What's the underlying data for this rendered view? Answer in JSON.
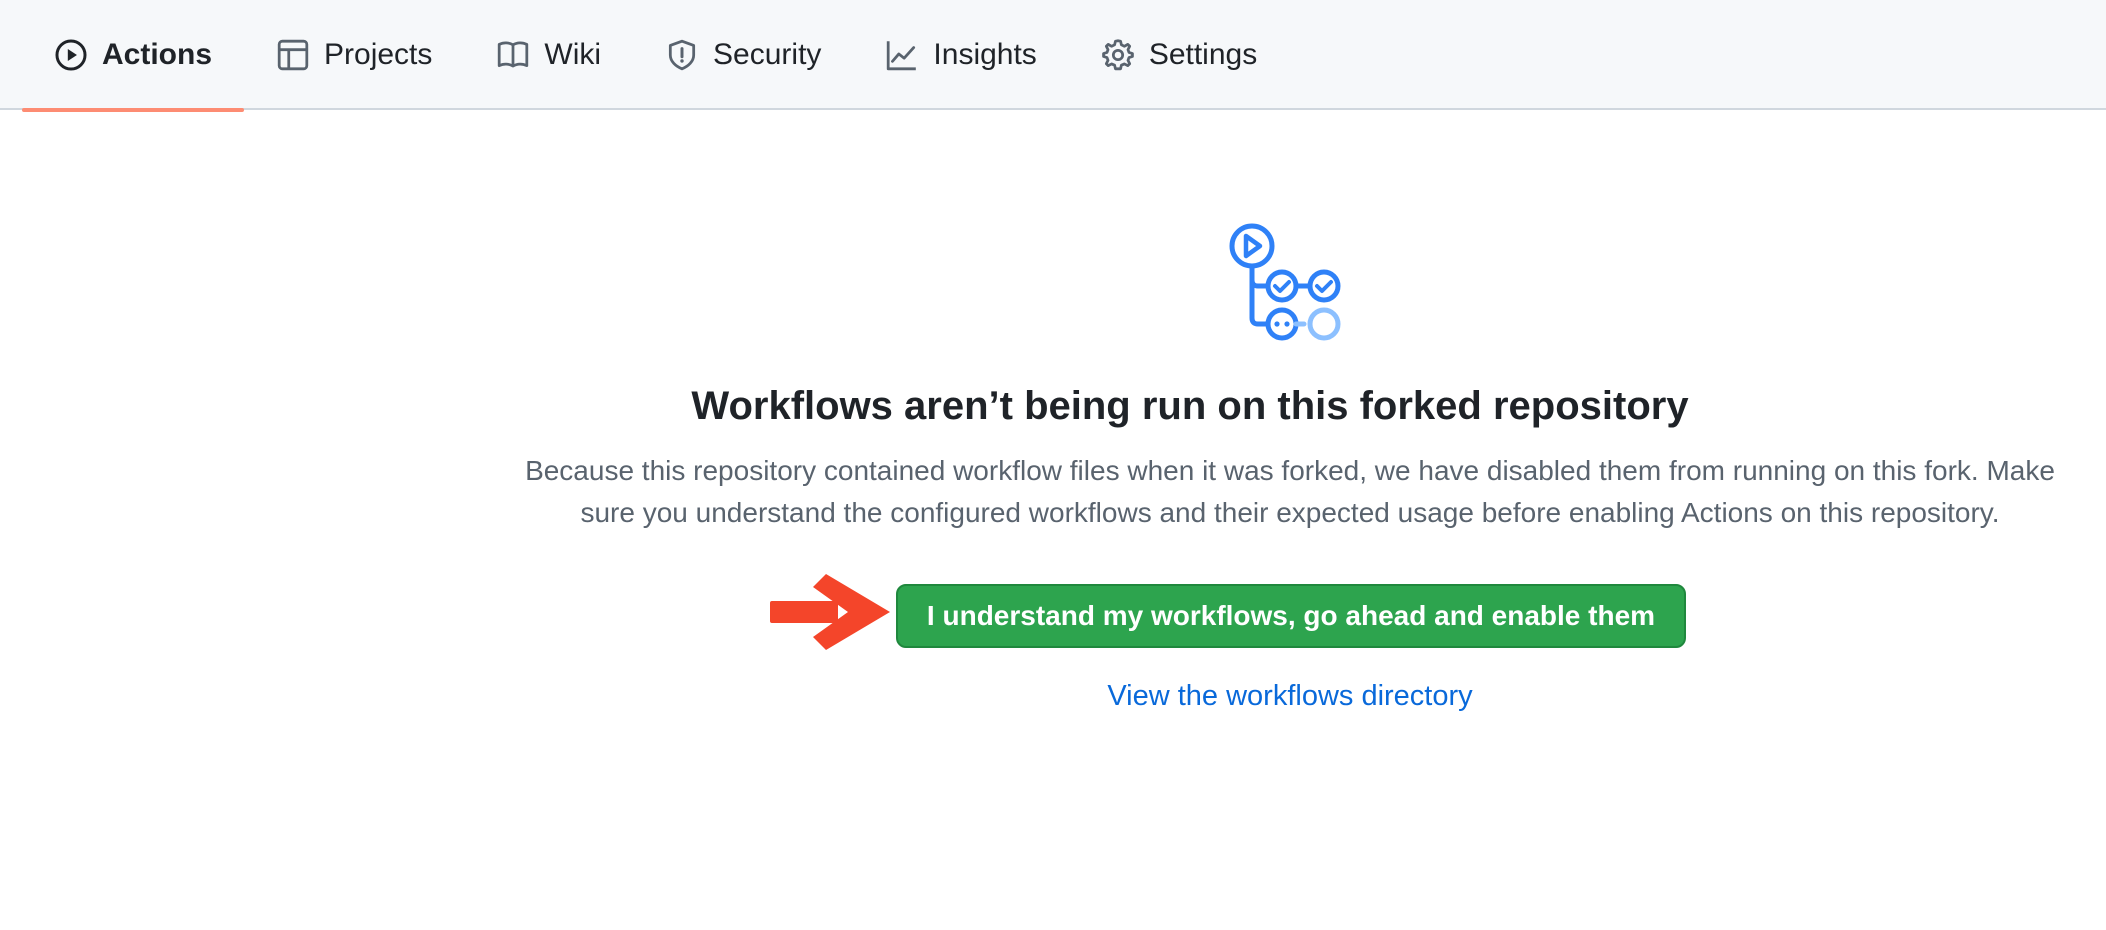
{
  "tabs": [
    {
      "label": "Actions",
      "icon": "play-icon",
      "selected": true
    },
    {
      "label": "Projects",
      "icon": "table-icon",
      "selected": false
    },
    {
      "label": "Wiki",
      "icon": "book-icon",
      "selected": false
    },
    {
      "label": "Security",
      "icon": "shield-icon",
      "selected": false
    },
    {
      "label": "Insights",
      "icon": "graph-icon",
      "selected": false
    },
    {
      "label": "Settings",
      "icon": "gear-icon",
      "selected": false
    }
  ],
  "main": {
    "title": "Workflows aren’t being run on this forked repository",
    "description_line1": "Because this repository contained workflow files when it was forked, we have disabled them from running on this fork. Make",
    "description_line2": "sure you understand the configured workflows and their expected usage before enabling Actions on this repository.",
    "enable_button_label": "I understand my workflows, go ahead and enable them",
    "directory_link": "View the workflows directory"
  },
  "colors": {
    "accent_underline": "#fd8c73",
    "button_green": "#2da44e",
    "link_blue": "#0969da",
    "arrow_red": "#f4452a",
    "icon_blue": "#2f81f7"
  }
}
